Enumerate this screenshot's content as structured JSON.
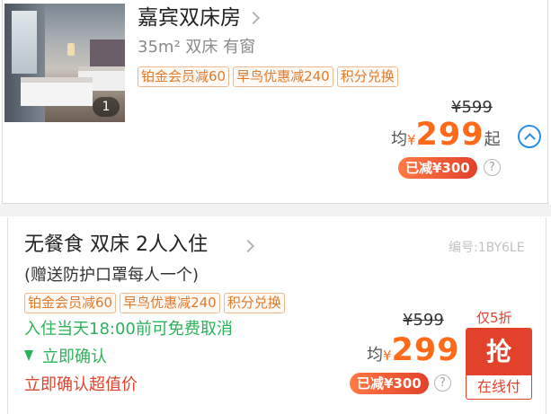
{
  "room": {
    "title": "嘉宾双床房",
    "meta": "35m² 双床 有窗",
    "photo_count": "1",
    "tags": [
      "铂金会员减60",
      "早鸟优惠减240",
      "积分兑换"
    ],
    "original_price": "¥599",
    "avg_label": "均",
    "currency": "¥",
    "price": "299",
    "suffix": "起",
    "discount": "已减¥300",
    "help": "?"
  },
  "plan": {
    "title": "无餐食 双床 2人入住",
    "code": "编号:1BY6LE",
    "gift": "(赠送防护口罩每人一个)",
    "tags": [
      "铂金会员减60",
      "早鸟优惠减240",
      "积分兑换"
    ],
    "cancel_policy": "入住当天18:00前可免费取消",
    "confirm": "立即确认",
    "value_label": "立即确认超值价",
    "original_price": "¥599",
    "avg_label": "均",
    "currency": "¥",
    "price": "299",
    "discount": "已减¥300",
    "help": "?",
    "sale_label": "仅5折",
    "book_main": "抢",
    "book_sub": "在线付"
  },
  "colors": {
    "price": "#ff6a1a",
    "accent_red": "#e2412b",
    "green": "#2bb35a",
    "blue": "#2a8ee8",
    "tag_orange": "#e07a2c"
  },
  "icons": {
    "collapse": "chevron-up-circle-icon",
    "more": "chevron-right-icon",
    "confirm": "lightning-icon",
    "help": "question-circle-icon"
  }
}
